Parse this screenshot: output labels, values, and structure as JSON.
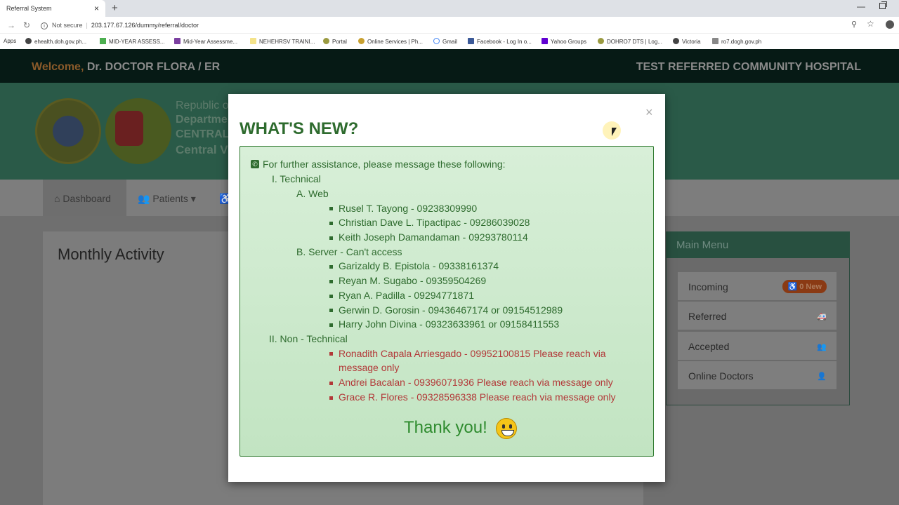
{
  "browser": {
    "tab_title": "Referral System",
    "tab_close": "×",
    "new_tab": "+",
    "not_secure": "Not secure",
    "url": "203.177.67.126/dummy/referral/doctor",
    "bookmarks": [
      "Apps",
      "ehealth.doh.gov.ph...",
      "MID-YEAR ASSESS...",
      "Mid-Year Assessme...",
      "NEHEHRSV TRAINI...",
      "Portal",
      "Online Services | Ph...",
      "Gmail",
      "Facebook - Log In o...",
      "Yahoo Groups",
      "DOHRO7 DTS | Log...",
      "Victoria",
      "ro7.dogh.gov.ph"
    ]
  },
  "header": {
    "welcome_word": "Welcome,",
    "user": "Dr. DOCTOR FLORA / ER",
    "hospital": "TEST REFERRED COMMUNITY HOSPITAL"
  },
  "banner": {
    "line1": "Republic of",
    "line2": "Departme",
    "line3": "CENTRAL",
    "line4": "Central V"
  },
  "nav": {
    "dashboard": "Dashboard",
    "patients": "Patients"
  },
  "content": {
    "card_title": "Monthly Activity"
  },
  "main_menu": {
    "title": "Main Menu",
    "incoming": "Incoming",
    "incoming_badge": "0 New",
    "referred": "Referred",
    "accepted": "Accepted",
    "online_doctors": "Online Doctors"
  },
  "modal": {
    "title": "WHAT'S NEW?",
    "close": "×",
    "intro": "For further assistance, please message these following:",
    "technical_heading": "I. Technical",
    "web_heading": "A. Web",
    "web_contacts": [
      "Rusel T. Tayong - 09238309990",
      "Christian Dave L. Tipactipac - 09286039028",
      "Keith Joseph Damandaman - 09293780114"
    ],
    "server_heading": "B. Server - Can't access",
    "server_contacts": [
      "Garizaldy B. Epistola - 09338161374",
      "Reyan M. Sugabo - 09359504269",
      "Ryan A. Padilla - 09294771871",
      "Gerwin D. Gorosin - 09436467174 or 09154512989",
      "Harry John Divina - 09323633961 or 09158411553"
    ],
    "nontech_heading": "II. Non - Technical",
    "nontech_contact_1_line1": "Ronadith Capala Arriesgado - 09952100815 Please reach via",
    "nontech_contact_1_line2": "message only",
    "nontech_contacts": [
      "Andrei Bacalan - 09396071936 Please reach via message only",
      "Grace R. Flores - 09328596338 Please reach via message only"
    ],
    "thanks": "Thank you!"
  }
}
